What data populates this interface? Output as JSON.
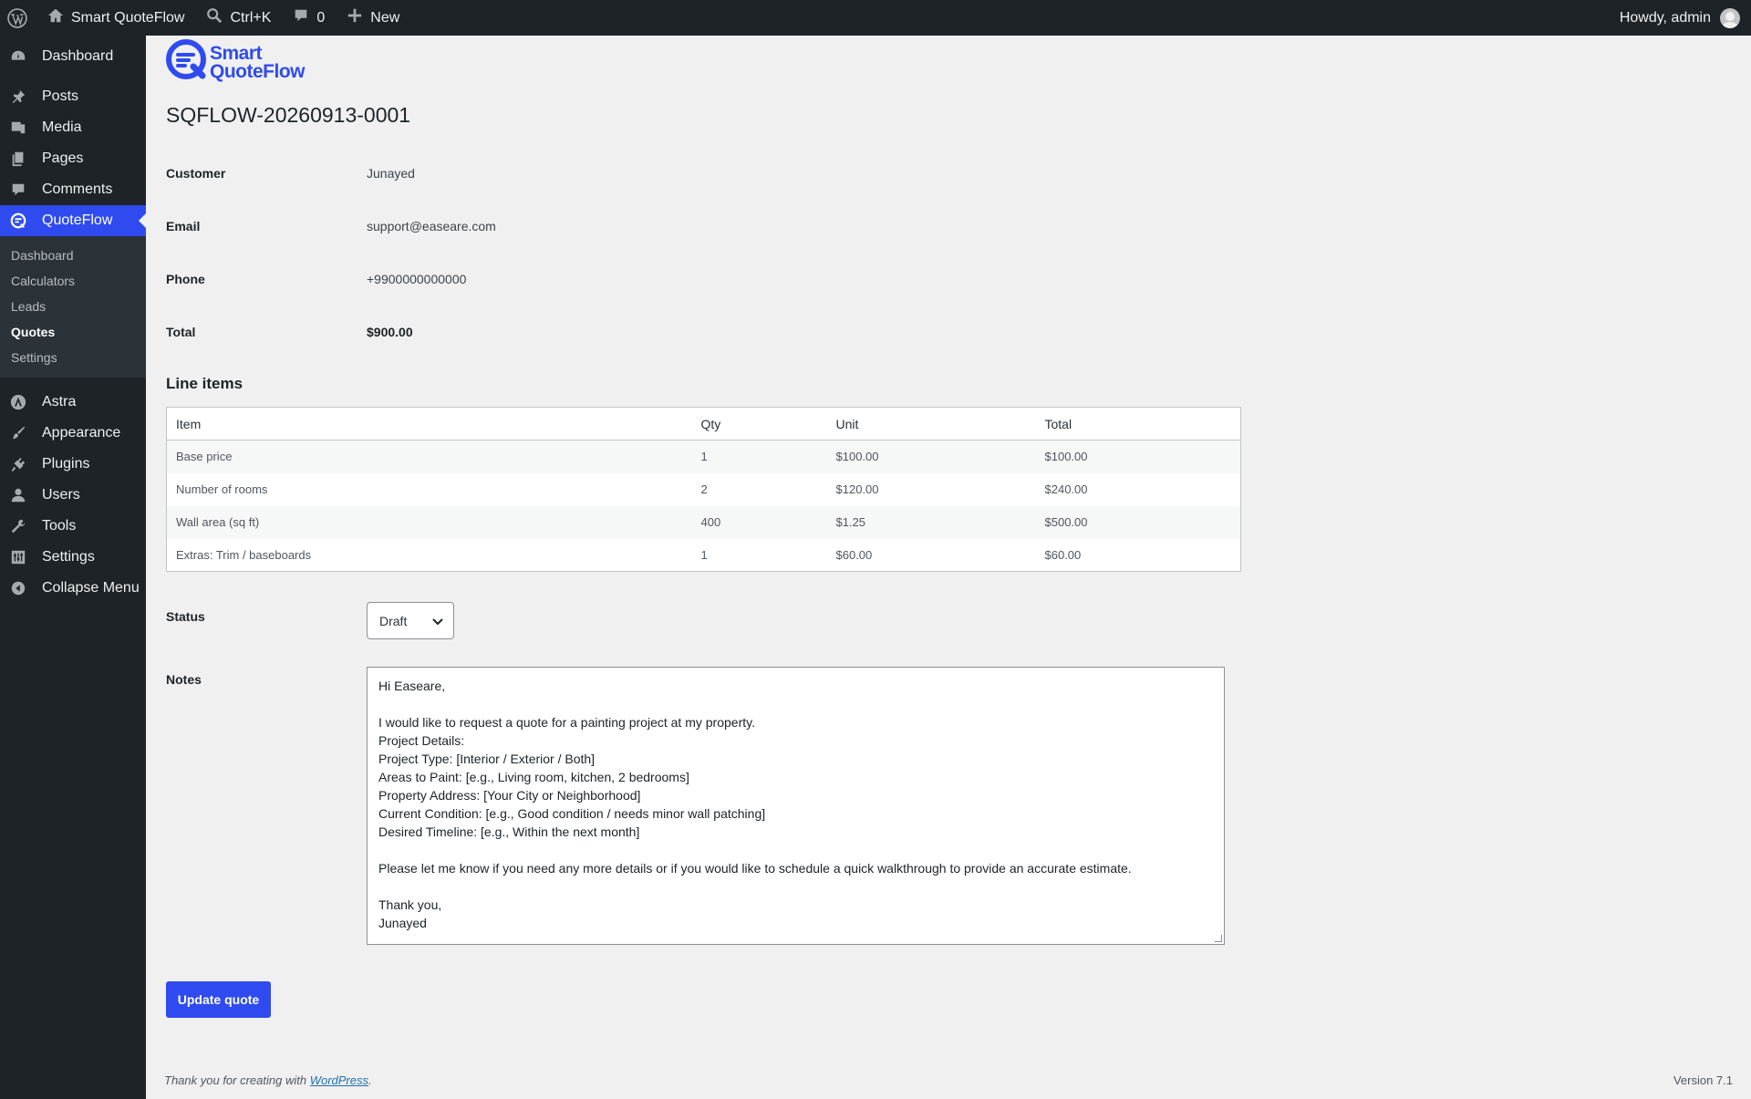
{
  "adminbar": {
    "site_name": "Smart QuoteFlow",
    "search_shortcut": "Ctrl+K",
    "comments_count": "0",
    "new_label": "New",
    "greeting": "Howdy, admin"
  },
  "sidebar": {
    "items": [
      {
        "label": "Dashboard",
        "icon": "dashboard-icon"
      },
      {
        "label": "Posts",
        "icon": "pin-icon"
      },
      {
        "label": "Media",
        "icon": "media-icon"
      },
      {
        "label": "Pages",
        "icon": "pages-icon"
      },
      {
        "label": "Comments",
        "icon": "comment-icon"
      },
      {
        "label": "QuoteFlow",
        "icon": "quoteflow-icon"
      },
      {
        "label": "Astra",
        "icon": "astra-icon"
      },
      {
        "label": "Appearance",
        "icon": "brush-icon"
      },
      {
        "label": "Plugins",
        "icon": "plugin-icon"
      },
      {
        "label": "Users",
        "icon": "user-icon"
      },
      {
        "label": "Tools",
        "icon": "wrench-icon"
      },
      {
        "label": "Settings",
        "icon": "settings-icon"
      },
      {
        "label": "Collapse Menu",
        "icon": "collapse-icon"
      }
    ],
    "submenu": [
      "Dashboard",
      "Calculators",
      "Leads",
      "Quotes",
      "Settings"
    ],
    "active_submenu": "Quotes"
  },
  "logo": {
    "line1": "Smart",
    "line2": "QuoteFlow"
  },
  "quote": {
    "id": "SQFLOW-20260913-0001",
    "customer_label": "Customer",
    "customer": "Junayed",
    "email_label": "Email",
    "email": "support@easeare.com",
    "phone_label": "Phone",
    "phone": "+9900000000000",
    "total_label": "Total",
    "total": "$900.00"
  },
  "line_items": {
    "heading": "Line items",
    "columns": [
      "Item",
      "Qty",
      "Unit",
      "Total"
    ],
    "rows": [
      [
        "Base price",
        "1",
        "$100.00",
        "$100.00"
      ],
      [
        "Number of rooms",
        "2",
        "$120.00",
        "$240.00"
      ],
      [
        "Wall area (sq ft)",
        "400",
        "$1.25",
        "$500.00"
      ],
      [
        "Extras: Trim / baseboards",
        "1",
        "$60.00",
        "$60.00"
      ]
    ]
  },
  "status": {
    "label": "Status",
    "value": "Draft"
  },
  "notes": {
    "label": "Notes",
    "text": "Hi Easeare,\n\nI would like to request a quote for a painting project at my property.\nProject Details:\nProject Type: [Interior / Exterior / Both]\nAreas to Paint: [e.g., Living room, kitchen, 2 bedrooms]\nProperty Address: [Your City or Neighborhood]\nCurrent Condition: [e.g., Good condition / needs minor wall patching]\nDesired Timeline: [e.g., Within the next month]\n\nPlease let me know if you need any more details or if you would like to schedule a quick walkthrough to provide an accurate estimate.\n\nThank you,\nJunayed"
  },
  "update_button": "Update quote",
  "footer": {
    "thanks_prefix": "Thank you for creating with ",
    "wp_link": "WordPress",
    "thanks_suffix": ".",
    "version": "Version 7.1"
  },
  "colors": {
    "accent": "#2f4bf0",
    "adminbar": "#1d2327",
    "background": "#f0f0f1"
  }
}
